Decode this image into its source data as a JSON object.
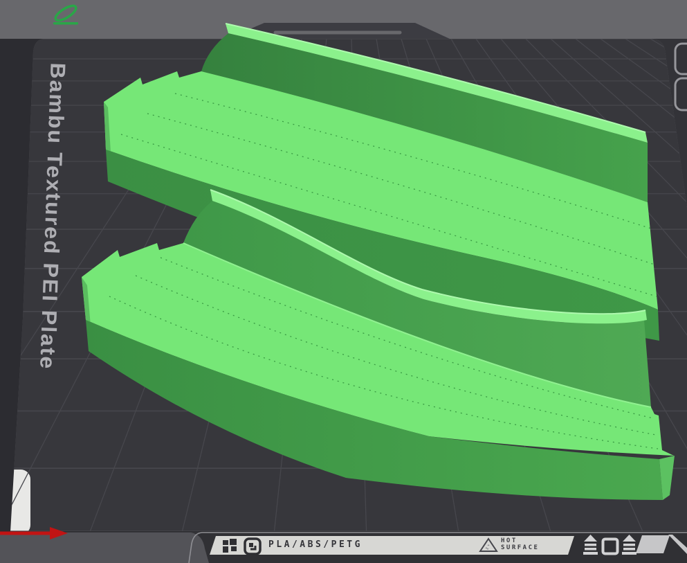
{
  "viewport": {
    "background_color": "#68686c",
    "plate": {
      "name": "build-plate",
      "surface_color": "#37373c",
      "grid_color": "#47474d",
      "brand_label": "Bambu Textured PEI Plate",
      "label_strip": {
        "materials": "PLA/ABS/PETG",
        "warning_line1": "HOT",
        "warning_line2": "SURFACE",
        "strip_color": "#d7d7d4",
        "text_color": "#35353a",
        "icons": [
          "bambu-logo-icon",
          "plate-badge-icon",
          "warning-triangle-icon",
          "eject-arrow-icon",
          "plate-outline-icon",
          "eject-arrow-icon"
        ]
      }
    },
    "axis_indicator": {
      "axis": "x",
      "color": "#c11414"
    },
    "corner_logo": {
      "name": "pencil-logo-icon",
      "color": "#2aa648"
    },
    "models": {
      "count": 2,
      "object_color": "#76e777",
      "items": [
        {
          "name": "curved-track-group-rear"
        },
        {
          "name": "curved-track-group-front"
        }
      ]
    }
  }
}
